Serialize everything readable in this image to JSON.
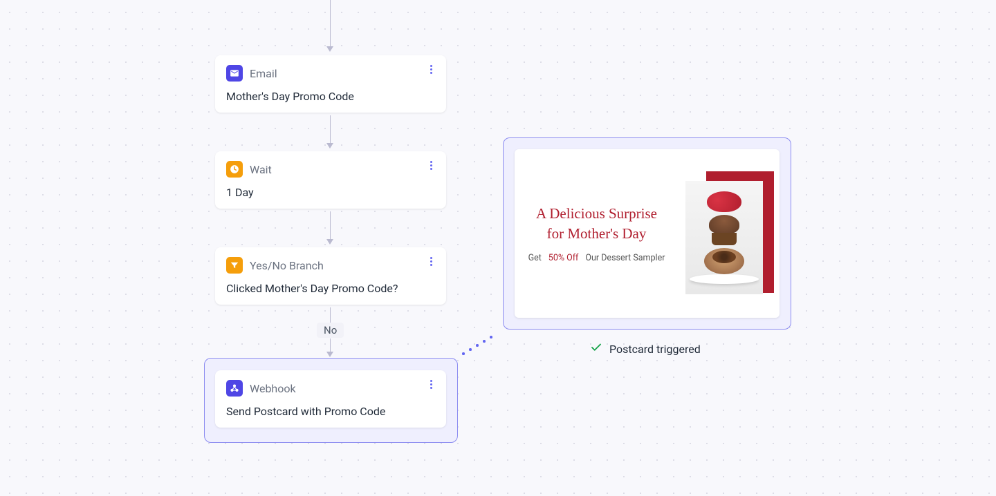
{
  "nodes": {
    "email": {
      "type": "Email",
      "title": "Mother's Day Promo Code"
    },
    "wait": {
      "type": "Wait",
      "title": "1 Day"
    },
    "branch": {
      "type": "Yes/No Branch",
      "title": "Clicked Mother's Day Promo Code?"
    },
    "webhook": {
      "type": "Webhook",
      "title": "Send Postcard with Promo Code"
    }
  },
  "branch_label": "No",
  "postcard": {
    "title_line1": "A Delicious Surprise",
    "title_line2": "for Mother's Day",
    "sub_get": "Get",
    "sub_discount": "50% Off",
    "sub_item": "Our Dessert Sampler"
  },
  "triggered": "Postcard triggered"
}
